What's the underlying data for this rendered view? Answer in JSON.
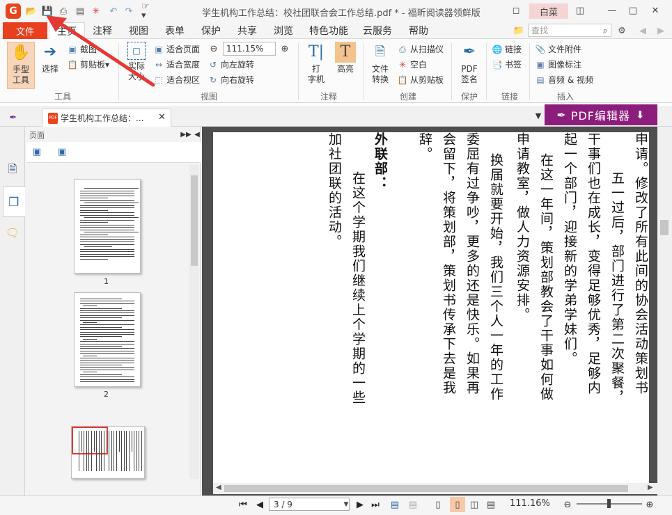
{
  "window": {
    "title": "学生机构工作总结：校社团联合会工作总结.pdf * - 福昕阅读器领鲜版",
    "user_button": "白菜"
  },
  "menu": {
    "tabs": [
      "文件",
      "主页",
      "注释",
      "视图",
      "表单",
      "保护",
      "共享",
      "浏览",
      "特色功能",
      "云服务",
      "帮助"
    ],
    "search_placeholder": "查找"
  },
  "ribbon": {
    "tools": {
      "hand": "手型\n工具",
      "select": "选择",
      "snapshot": "截图",
      "clipboard": "剪贴板",
      "group": "工具"
    },
    "view": {
      "actual_size": "实际\n大小",
      "fit_page": "适合页面",
      "fit_width": "适合宽度",
      "fit_visible": "适合视区",
      "zoom": "111.15%",
      "rotate_left": "向左旋转",
      "rotate_right": "向右旋转",
      "group": "视图"
    },
    "annotate": {
      "typewriter": "打\n字机",
      "highlight": "高亮",
      "group": "注释"
    },
    "create": {
      "convert": "文件\n转换",
      "from_scanner": "从扫描仪",
      "blank": "空白",
      "from_clipboard": "从剪贴板",
      "group": "创建"
    },
    "protect": {
      "pdf_sign": "PDF\n签名",
      "group": "保护"
    },
    "links": {
      "link": "链接",
      "bookmark": "书签",
      "group": "链接"
    },
    "insert": {
      "attachment": "文件附件",
      "image": "图像标注",
      "media": "音频 & 视频",
      "group": "插入"
    }
  },
  "doc_tab": {
    "label": "学生机构工作总结：..."
  },
  "editor_button": "PDF编辑器",
  "panel": {
    "title": "页面",
    "pages": [
      "1",
      "2"
    ]
  },
  "document": {
    "columns": [
      "申请。修改了所有此间的协会活动策划书",
      "五一过后，部门进行了第二次聚餐，",
      "干事们也在成长，变得足够优秀，足够内",
      "起一个部门，迎接新的学弟学妹们。",
      "在这一年间，策划部教会了干事如何做",
      "申请教室，做人力资源安排。",
      "换届就要开始，我们三个人一年的工作",
      "委屈有过争吵，更多的还是快乐。如果再",
      "会留下，将策划部，策划书传承下去是我",
      "辞。",
      "外联部：",
      "在这个学期我们继续上个学期的一些",
      "加社团联的活动。"
    ]
  },
  "status": {
    "page": "3 / 9",
    "zoom": "111.16%"
  },
  "colors": {
    "accent": "#e8401f",
    "editor_purple": "#8d1d7c",
    "arrow_red": "#e53935"
  }
}
